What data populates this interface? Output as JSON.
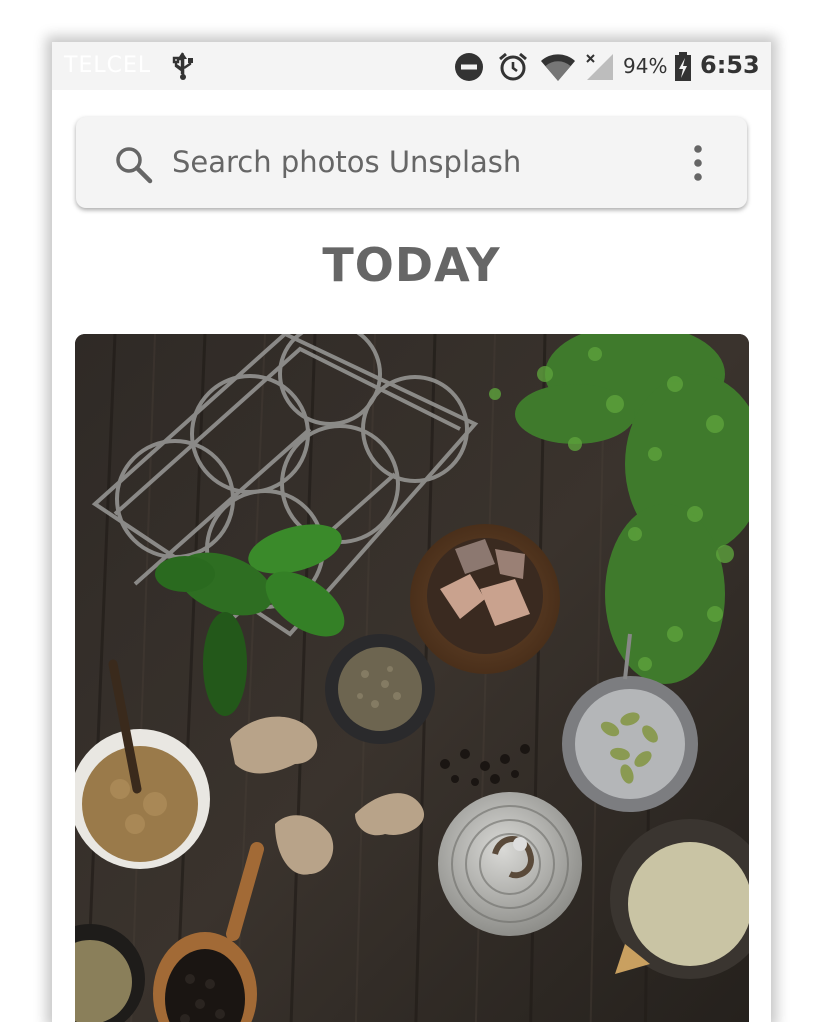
{
  "status_bar": {
    "carrier": "TELCEL",
    "battery_percent": "94%",
    "time": "6:53",
    "icons": [
      "usb-icon",
      "do-not-disturb-icon",
      "alarm-icon",
      "wifi-icon",
      "cell-signal-icon",
      "battery-charging-icon"
    ]
  },
  "search": {
    "placeholder": "Search photos Unsplash",
    "value": ""
  },
  "section": {
    "title": "TODAY"
  },
  "photo": {
    "subject": "spices-and-herbs-flat-lay"
  },
  "colors": {
    "text_gray": "#666666",
    "search_bg": "#f4f4f4",
    "status_bg": "#f4f4f4"
  }
}
